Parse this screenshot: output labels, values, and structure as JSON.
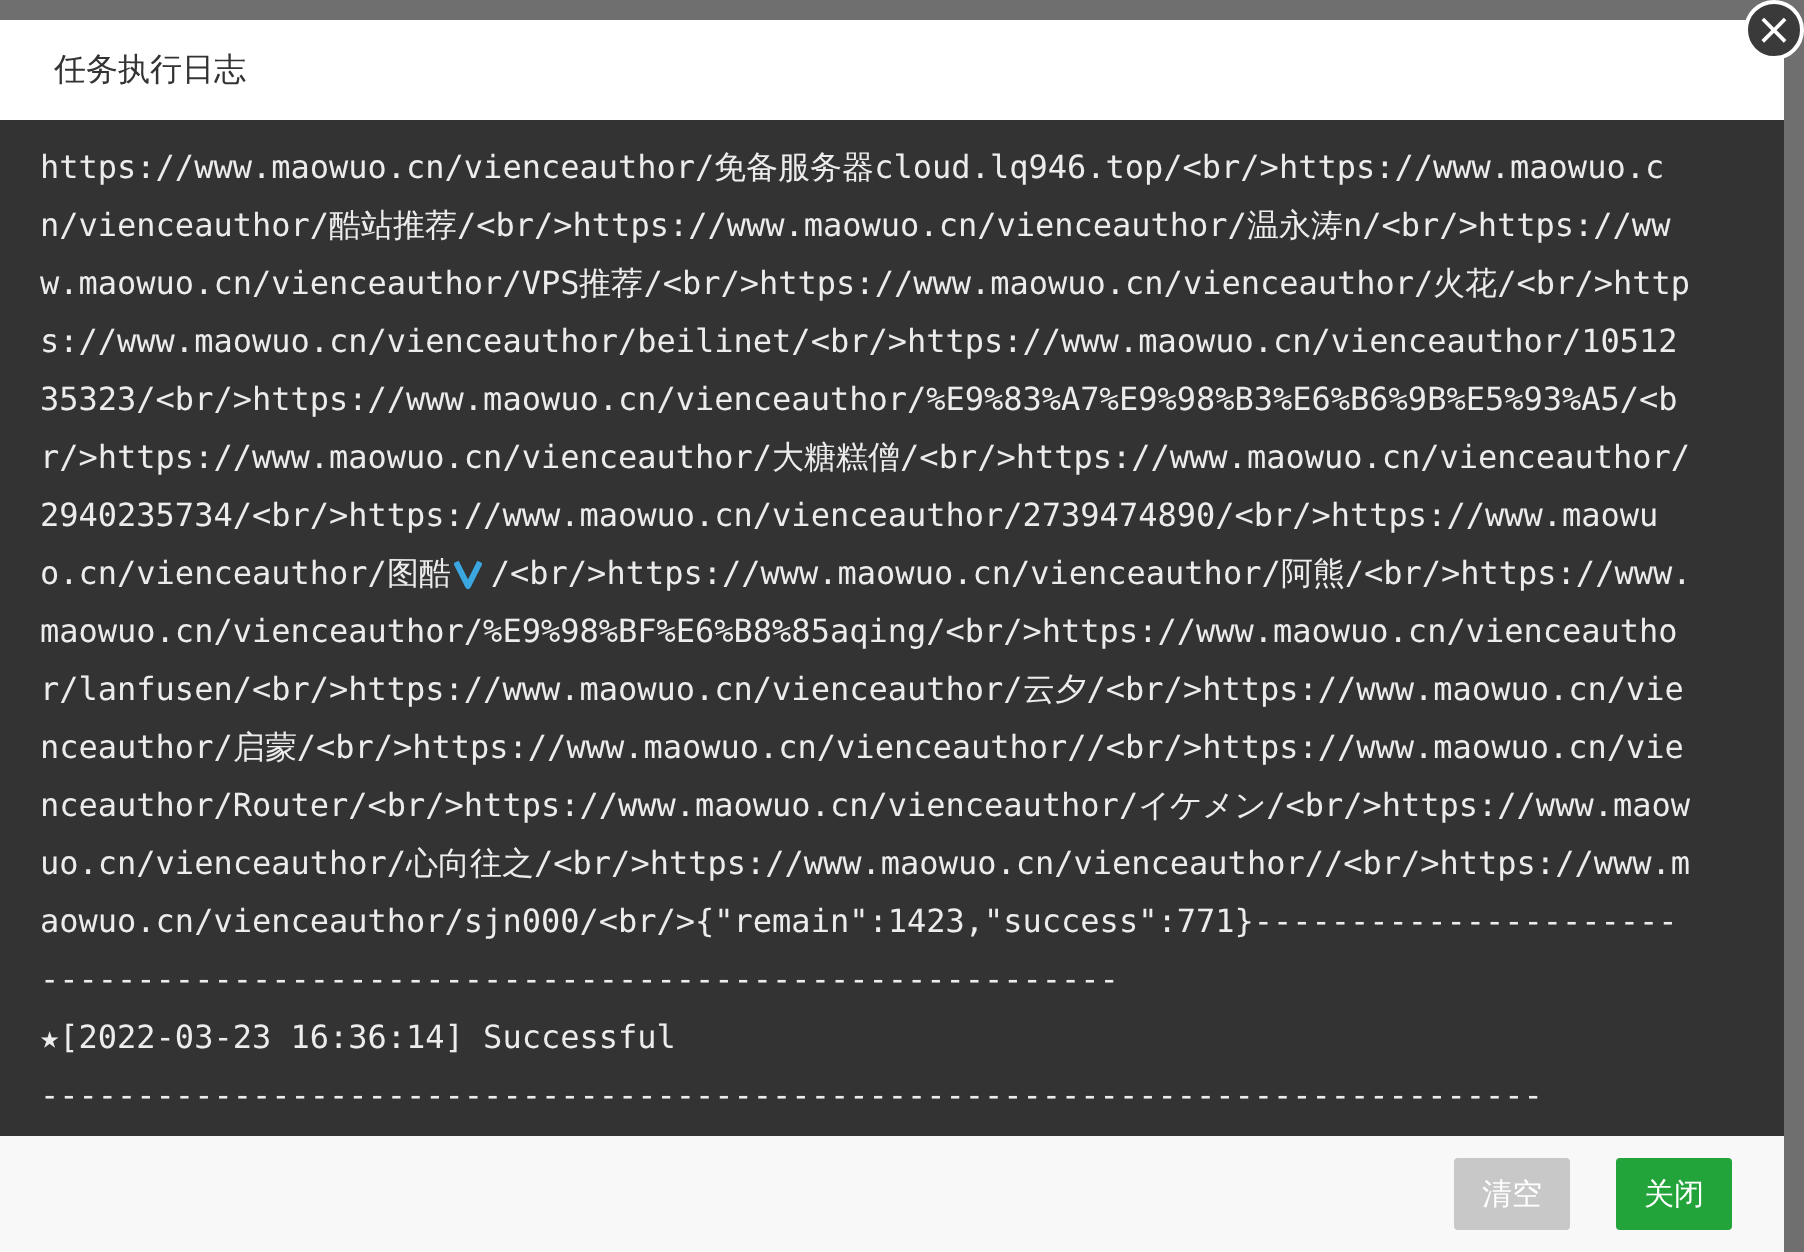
{
  "dialog": {
    "title": "任务执行日志",
    "close_icon": "×",
    "log_lines": [
      {
        "kind": "text",
        "text": "https://www.maowuo.cn/vienceauthor/免备服务器cloud.lq946.top/<br/>https://www.maowuo.c"
      },
      {
        "kind": "text",
        "text": "n/vienceauthor/酷站推荐/<br/>https://www.maowuo.cn/vienceauthor/温永涛n/<br/>https://ww"
      },
      {
        "kind": "text",
        "text": "w.maowuo.cn/vienceauthor/VPS推荐/<br/>https://www.maowuo.cn/vienceauthor/火花/<br/>http"
      },
      {
        "kind": "text",
        "text": "s://www.maowuo.cn/vienceauthor/beilinet/<br/>https://www.maowuo.cn/vienceauthor/10512"
      },
      {
        "kind": "text",
        "text": "35323/<br/>https://www.maowuo.cn/vienceauthor/%E9%83%A7%E9%98%B3%E6%B6%9B%E5%93%A5/<b"
      },
      {
        "kind": "text",
        "text": "r/>https://www.maowuo.cn/vienceauthor/大糖糕僧/<br/>https://www.maowuo.cn/vienceauthor/"
      },
      {
        "kind": "text",
        "text": "2940235734/<br/>https://www.maowuo.cn/vienceauthor/2739474890/<br/>https://www.maowu"
      },
      {
        "kind": "badge",
        "before": "o.cn/vienceauthor/图酷",
        "after": "/<br/>https://www.maowuo.cn/vienceauthor/阿熊/<br/>https://www."
      },
      {
        "kind": "text",
        "text": "maowuo.cn/vienceauthor/%E9%98%BF%E6%B8%85aqing/<br/>https://www.maowuo.cn/vienceautho"
      },
      {
        "kind": "text",
        "text": "r/lanfusen/<br/>https://www.maowuo.cn/vienceauthor/云夕/<br/>https://www.maowuo.cn/vie"
      },
      {
        "kind": "text",
        "text": "nceauthor/启蒙/<br/>https://www.maowuo.cn/vienceauthor//<br/>https://www.maowuo.cn/vie"
      },
      {
        "kind": "text",
        "text": "nceauthor/Router/<br/>https://www.maowuo.cn/vienceauthor/イケメン/<br/>https://www.maow"
      },
      {
        "kind": "text",
        "text": "uo.cn/vienceauthor/心向往之/<br/>https://www.maowuo.cn/vienceauthor//<br/>https://www.m"
      },
      {
        "kind": "text",
        "text": "aowuo.cn/vienceauthor/sjn000/<br/>{\"remain\":1423,\"success\":771}----------------------"
      },
      {
        "kind": "text",
        "text": "--------------------------------------------------------"
      },
      {
        "kind": "text",
        "text": "★[2022-03-23 16:36:14] Successful"
      },
      {
        "kind": "text",
        "text": "------------------------------------------------------------------------------"
      }
    ],
    "buttons": [
      {
        "label": "清空",
        "kind": "secondary"
      },
      {
        "label": "关闭",
        "kind": "primary"
      }
    ]
  }
}
